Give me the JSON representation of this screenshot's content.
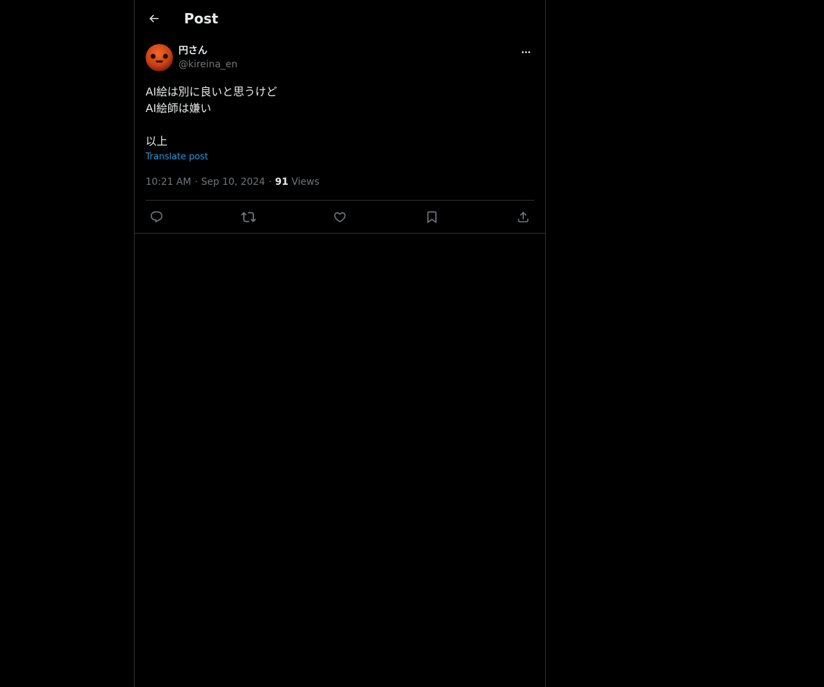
{
  "header": {
    "title": "Post"
  },
  "post": {
    "author": {
      "display_name": "円さん",
      "handle": "@kireina_en"
    },
    "text": "AI絵は別に良いと思うけど\nAI絵師は嫌い\n\n以上",
    "translate_label": "Translate post",
    "time": "10:21 AM",
    "date": "Sep 10, 2024",
    "views_count": "91",
    "views_label": "Views",
    "separator": "·"
  },
  "actions": [
    "reply-icon",
    "repost-icon",
    "like-icon",
    "bookmark-icon",
    "share-icon"
  ],
  "colors": {
    "background": "#000000",
    "text": "#e7e9ea",
    "secondary": "#71767b",
    "link": "#1d9bf0",
    "border": "#2f3336",
    "avatar": "#d9471c"
  }
}
